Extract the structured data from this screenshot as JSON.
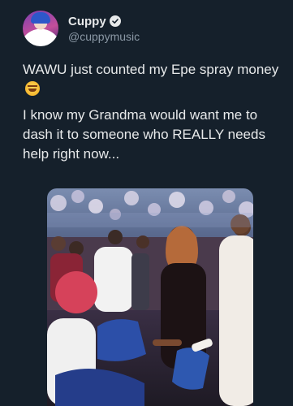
{
  "author": {
    "display_name": "Cuppy",
    "handle": "@cuppymusic",
    "verified_icon": "verified-badge-icon"
  },
  "tweet": {
    "line1": "WAWU just counted my Epe spray money",
    "line1_emoji": "grinning-sweat-emoji",
    "line2": "I know my Grandma would want me to dash it to someone who REALLY needs help right now..."
  },
  "media": {
    "type": "photo",
    "colors": {
      "background": "#15202b",
      "text": "#e7e9ea",
      "secondary_text": "#8b98a5"
    }
  }
}
